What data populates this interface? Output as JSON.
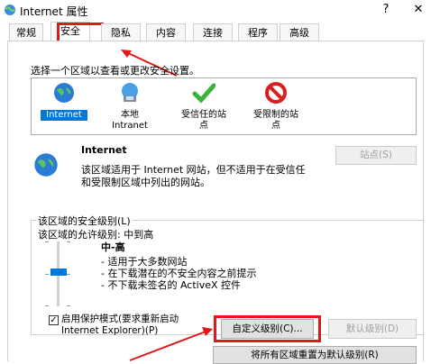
{
  "window": {
    "title": "Internet 属性",
    "help_label": "?",
    "close_label": "✕"
  },
  "tabs": [
    {
      "label": "常规"
    },
    {
      "label": "安全"
    },
    {
      "label": "隐私"
    },
    {
      "label": "内容"
    },
    {
      "label": "连接"
    },
    {
      "label": "程序"
    },
    {
      "label": "高级"
    }
  ],
  "security": {
    "zone_prompt": "选择一个区域以查看或更改安全设置。",
    "zones": [
      {
        "line1": "Internet",
        "line2": "",
        "selected": true,
        "icon": "globe-icon"
      },
      {
        "line1": "本地",
        "line2": "Intranet",
        "selected": false,
        "icon": "intranet-icon"
      },
      {
        "line1": "受信任的站",
        "line2": "点",
        "selected": false,
        "icon": "checkmark-icon"
      },
      {
        "line1": "受限制的站",
        "line2": "点",
        "selected": false,
        "icon": "restricted-icon"
      }
    ],
    "zone_title": "Internet",
    "zone_desc_line1": "该区域适用于 Internet 网站，但不适用于在受信任",
    "zone_desc_line2": "和受限制区域中列出的网站。",
    "sites_button": "站点(S)",
    "level_group_label": "该区域的安全级别(L)",
    "allowed_levels": "该区域的允许级别: 中到高",
    "current_level": "中-高",
    "bullets": [
      "- 适用于大多数网站",
      "- 在下载潜在的不安全内容之前提示",
      "- 不下载未签名的 ActiveX 控件"
    ],
    "level_value": 0.5,
    "protected_mode_line1": "启用保护模式(要求重新启动",
    "protected_mode_line2": "Internet Explorer)(P)",
    "protected_mode_checked": true,
    "custom_level_button": "自定义级别(C)...",
    "default_level_button": "默认级别(D)",
    "reset_all_button": "将所有区域重置为默认级别(R)"
  },
  "colors": {
    "highlight_box": "#e01818",
    "arrow": "#e01818",
    "selected_zone": "#0078d7",
    "slider_thumb": "#0078d7"
  }
}
